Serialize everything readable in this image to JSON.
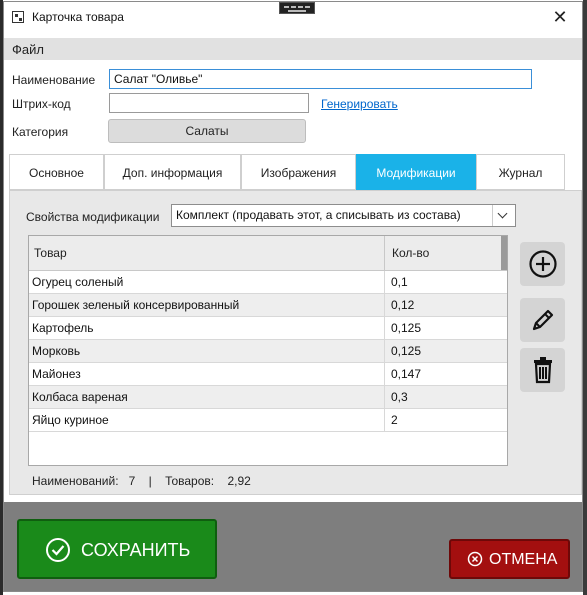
{
  "window": {
    "title": "Карточка товара"
  },
  "menu": {
    "file": "Файл"
  },
  "form": {
    "name_label": "Наименование",
    "name_value": "Салат \"Оливье\"",
    "barcode_label": "Штрих-код",
    "barcode_value": "",
    "generate_link": "Генерировать",
    "category_label": "Категория",
    "category_value": "Салаты"
  },
  "tabs": [
    {
      "label": "Основное",
      "active": false
    },
    {
      "label": "Доп. информация",
      "active": false
    },
    {
      "label": "Изображения",
      "active": false
    },
    {
      "label": "Модификации",
      "active": true
    },
    {
      "label": "Журнал",
      "active": false
    }
  ],
  "modifications": {
    "props_label": "Свойства модификации",
    "props_value": "Комплект (продавать этот, а списывать из состава)",
    "columns": [
      "Товар",
      "Кол-во"
    ],
    "rows": [
      {
        "name": "Огурец соленый",
        "qty": "0,1"
      },
      {
        "name": "Горошек зеленый консервированный",
        "qty": "0,12"
      },
      {
        "name": "Картофель",
        "qty": "0,125"
      },
      {
        "name": "Морковь",
        "qty": "0,125"
      },
      {
        "name": "Майонез",
        "qty": "0,147"
      },
      {
        "name": "Колбаса вареная",
        "qty": "0,3"
      },
      {
        "name": "Яйцо куриное",
        "qty": "2"
      }
    ],
    "summary": {
      "items_label": "Наименований:",
      "items_value": "7",
      "separator": "|",
      "goods_label": "Товаров:",
      "goods_value": "2,92"
    },
    "icons": [
      "plus-circle-icon",
      "pencil-icon",
      "trash-icon"
    ]
  },
  "buttons": {
    "save": "СОХРАНИТЬ",
    "cancel": "ОТМЕНА"
  },
  "colors": {
    "tab_active": "#1ab2e8",
    "save": "#1a8a1a",
    "cancel": "#a30f0f",
    "link": "#0066cc",
    "bottom_bar": "#7e7e7e"
  }
}
